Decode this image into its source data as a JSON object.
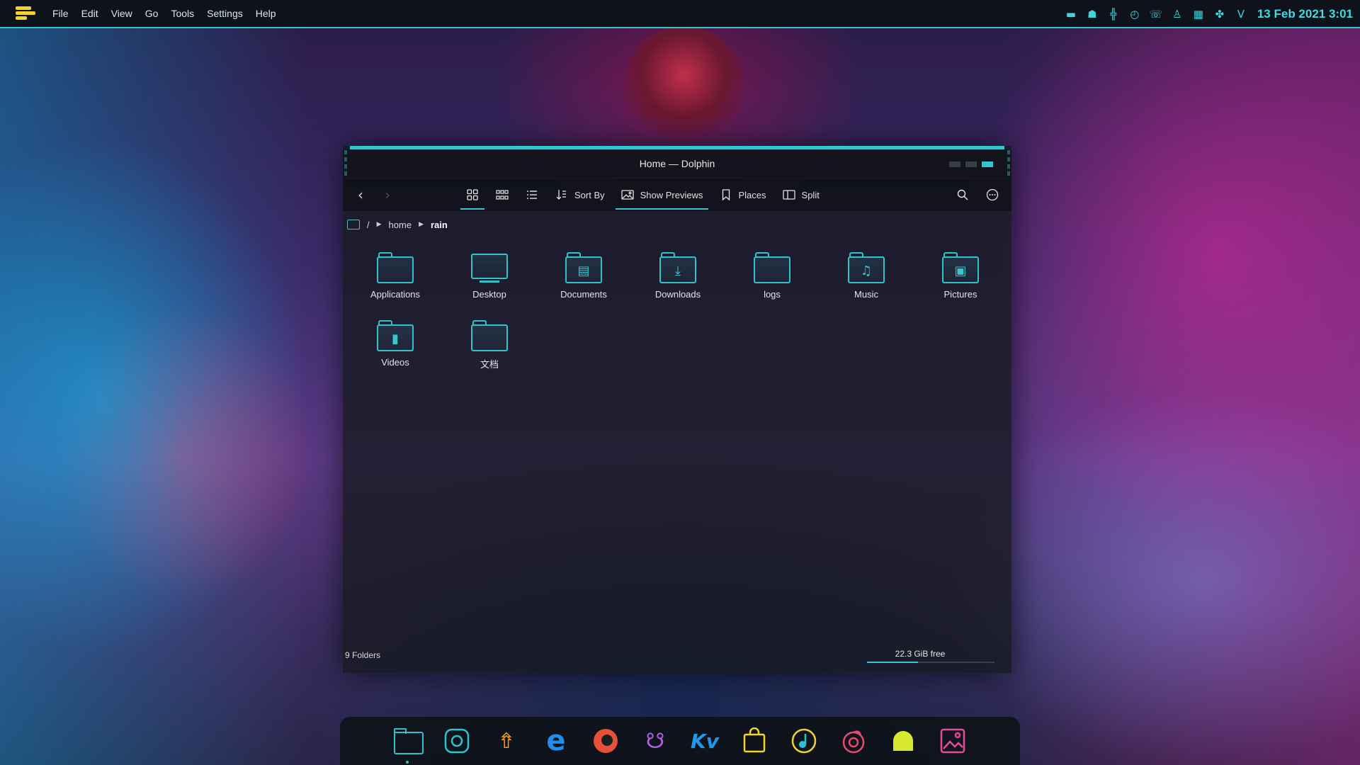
{
  "topbar": {
    "menu": [
      "File",
      "Edit",
      "View",
      "Go",
      "Tools",
      "Settings",
      "Help"
    ],
    "tray_icons": [
      "screen-icon",
      "helmet-icon",
      "network-activity-icon",
      "clock-icon",
      "phone-icon",
      "bell-icon",
      "keyboard-icon",
      "bluetooth-icon",
      "v-icon"
    ],
    "clock": "13 Feb 2021 3:01",
    "accent": "#29c6cf",
    "logo_color": "#f2d230"
  },
  "window": {
    "title": "Home — Dolphin",
    "toolbar": {
      "back_icon": "chevron-left-icon",
      "forward_icon": "chevron-right-icon",
      "view_modes": [
        "icons-view-icon",
        "compact-view-icon",
        "details-view-icon"
      ],
      "sort_by": "Sort By",
      "show_previews": "Show Previews",
      "places": "Places",
      "split": "Split",
      "search_icon": "search-icon",
      "menu_icon": "more-icon"
    },
    "breadcrumb": {
      "root": "/",
      "parts": [
        "home",
        "rain"
      ]
    },
    "files": [
      {
        "name": "Applications",
        "icon": "folder-icon"
      },
      {
        "name": "Desktop",
        "icon": "desktop-icon"
      },
      {
        "name": "Documents",
        "icon": "folder-documents-icon"
      },
      {
        "name": "Downloads",
        "icon": "folder-downloads-icon"
      },
      {
        "name": "logs",
        "icon": "folder-icon"
      },
      {
        "name": "Music",
        "icon": "folder-music-icon"
      },
      {
        "name": "Pictures",
        "icon": "folder-pictures-icon"
      },
      {
        "name": "Videos",
        "icon": "folder-videos-icon"
      },
      {
        "name": "文档",
        "icon": "folder-icon"
      }
    ],
    "status": {
      "folders": "9 Folders",
      "free_space": "22.3 GiB free",
      "used_fraction": 0.4
    }
  },
  "dock": {
    "apps": [
      "files-app-icon",
      "settings-app-icon",
      "launcher-app-icon",
      "browser-app-icon",
      "firefox-app-icon",
      "github-app-icon",
      "kv-app-icon",
      "store-app-icon",
      "music-app-icon",
      "media-app-icon",
      "chat-app-icon",
      "image-viewer-app-icon"
    ]
  }
}
